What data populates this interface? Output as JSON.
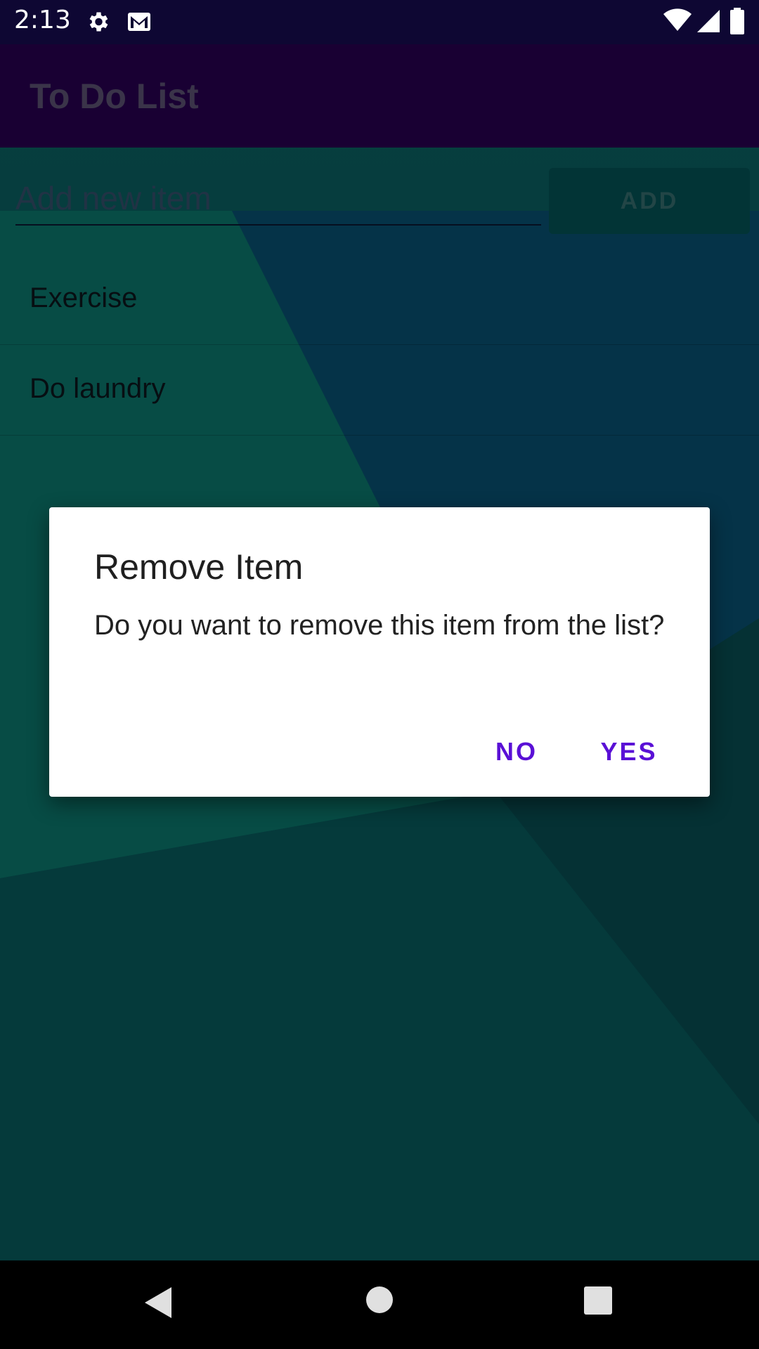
{
  "status_bar": {
    "time": "2:13",
    "icons": [
      "gear-icon",
      "mail-icon",
      "wifi-icon",
      "signal-icon",
      "battery-icon"
    ]
  },
  "app_bar": {
    "title": "To Do List"
  },
  "new_item": {
    "placeholder": "Add new item",
    "add_label": "ADD"
  },
  "list": {
    "items": [
      {
        "label": "Exercise"
      },
      {
        "label": "Do laundry"
      }
    ]
  },
  "dialog": {
    "title": "Remove Item",
    "message": "Do you want to remove this item from the list?",
    "no_label": "NO",
    "yes_label": "YES"
  },
  "nav_bar": {
    "icons": [
      "back-icon",
      "home-icon",
      "recents-icon"
    ]
  },
  "colors": {
    "status_bar": "#0e0733",
    "app_bar": "#2e005e",
    "dialog_button": "#5a10d6",
    "add_button": "#055f63"
  }
}
